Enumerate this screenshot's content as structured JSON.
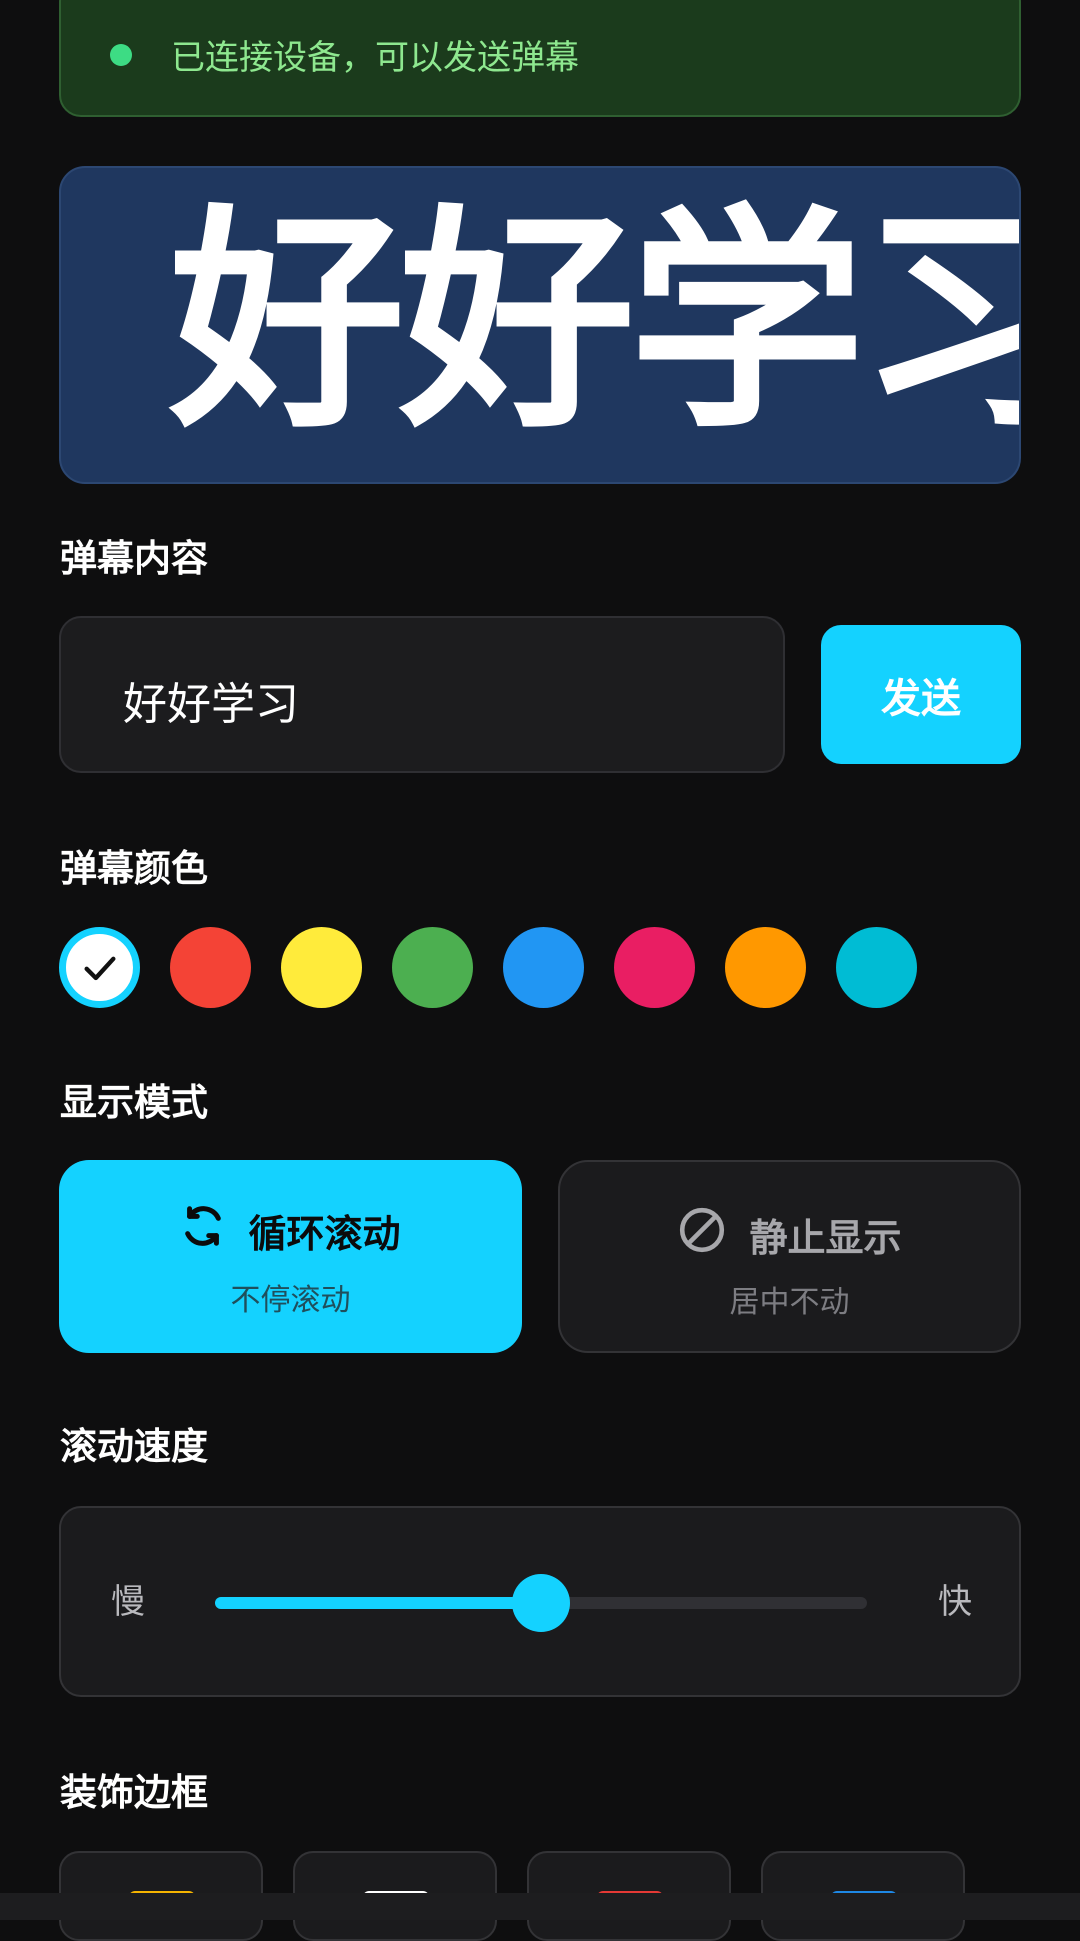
{
  "status": {
    "text": "已连接设备，可以发送弹幕",
    "dot_color": "#3ddc84"
  },
  "preview": {
    "text": "好好学习"
  },
  "content_section": {
    "title": "弹幕内容",
    "input_value": "好好学习",
    "send_label": "发送"
  },
  "color_section": {
    "title": "弹幕颜色",
    "swatches": [
      {
        "color": "#ffffff",
        "selected": true
      },
      {
        "color": "#f44336",
        "selected": false
      },
      {
        "color": "#ffeb3b",
        "selected": false
      },
      {
        "color": "#4caf50",
        "selected": false
      },
      {
        "color": "#2196f3",
        "selected": false
      },
      {
        "color": "#e91e63",
        "selected": false
      },
      {
        "color": "#ff9800",
        "selected": false
      },
      {
        "color": "#00bcd4",
        "selected": false
      }
    ]
  },
  "mode_section": {
    "title": "显示模式",
    "modes": [
      {
        "icon": "loop-icon",
        "label": "循环滚动",
        "sub": "不停滚动",
        "active": true
      },
      {
        "icon": "ban-icon",
        "label": "静止显示",
        "sub": "居中不动",
        "active": false
      }
    ]
  },
  "speed_section": {
    "title": "滚动速度",
    "slow_label": "慢",
    "fast_label": "快",
    "value": 0.5
  },
  "frame_section": {
    "title": "装饰边框",
    "frames": [
      {
        "color": "#f5b400"
      },
      {
        "color": "#ffffff"
      },
      {
        "color": "#e53935"
      },
      {
        "color": "#1e88e5"
      }
    ]
  },
  "accent_color": "#14d2ff"
}
